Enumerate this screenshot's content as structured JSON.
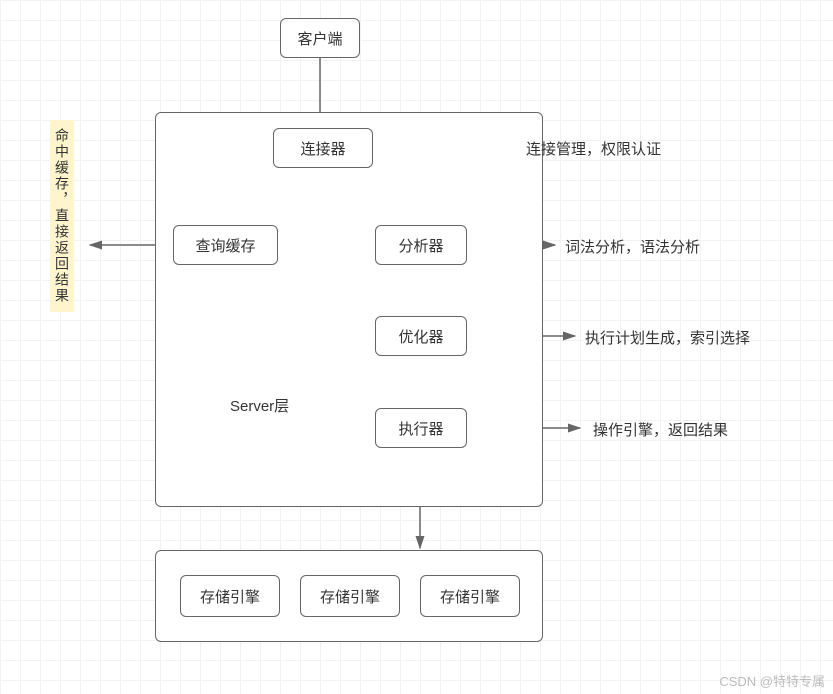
{
  "nodes": {
    "client": "客户端",
    "connector": "连接器",
    "cache": "查询缓存",
    "analyzer": "分析器",
    "optimizer": "优化器",
    "executor": "执行器",
    "storage1": "存储引擎",
    "storage2": "存储引擎",
    "storage3": "存储引擎"
  },
  "labels": {
    "server_layer": "Server层",
    "cache_hit": "命中缓存，直接返回结果",
    "connector_note": "连接管理，权限认证",
    "analyzer_note": "词法分析，语法分析",
    "optimizer_note": "执行计划生成，索引选择",
    "executor_note": "操作引擎，返回结果"
  },
  "watermark": "CSDN @特特专属"
}
